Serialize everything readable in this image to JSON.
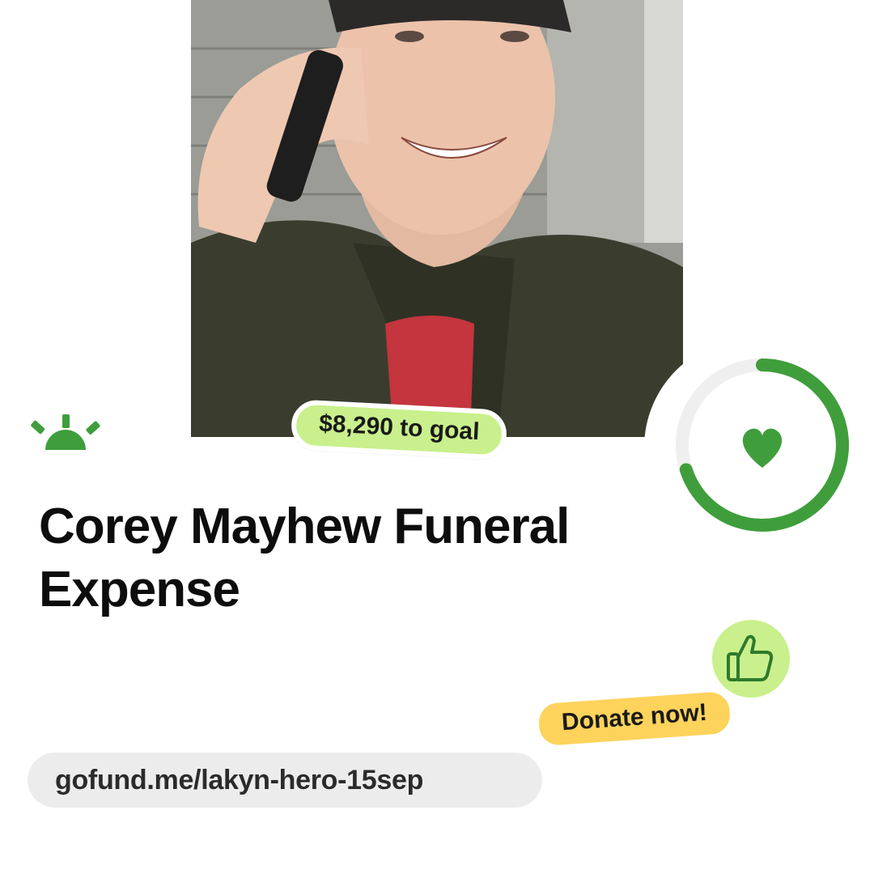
{
  "campaign": {
    "title": "Corey Mayhew Funeral Expense",
    "goal_text": "$8,290 to goal",
    "progress_fraction": 0.7,
    "donate_label": "Donate now!",
    "url": "gofund.me/lakyn-hero-15sep"
  },
  "icons": {
    "brand": "sun-rise-icon",
    "heart": "heart-icon",
    "thumb": "thumbs-up-icon"
  },
  "colors": {
    "brand_green": "#3f9e3b",
    "goal_badge": "#c9f08c",
    "donate_badge": "#fdd35b",
    "ring_track": "#efefef",
    "url_pill": "#ececec"
  }
}
